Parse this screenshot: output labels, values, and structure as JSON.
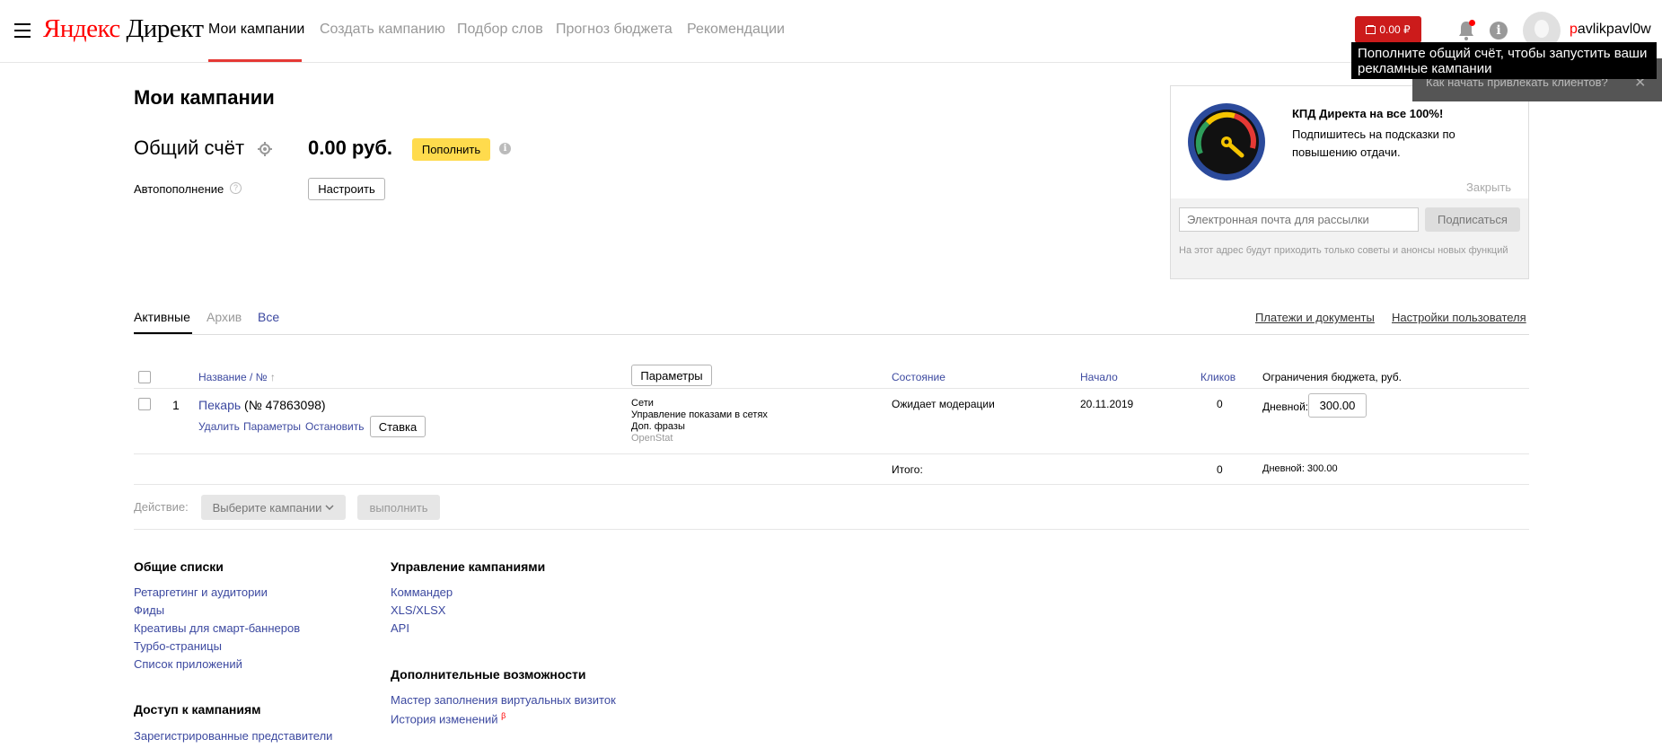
{
  "header": {
    "logo": {
      "ya": "Яндекс",
      "direct": "Директ"
    },
    "nav": [
      "Мои кампании",
      "Создать кампанию",
      "Подбор слов",
      "Прогноз бюджета",
      "Рекомендации"
    ],
    "balance": "0.00 ₽",
    "username_first": "p",
    "username_rest": "avlikpavl0w"
  },
  "tooltip": {
    "text": "Пополните общий счёт, чтобы запустить ваши рекламные кампании",
    "behind_text": "Как начать привлекать клиентов?",
    "close": "✕"
  },
  "page": {
    "title": "Мои кампании",
    "account_label": "Общий счёт",
    "amount": "0.00 руб.",
    "topup_label": "Пополнить",
    "autotopup_label": "Автопополнение",
    "autotopup_help": "?",
    "configure_label": "Настроить"
  },
  "promo": {
    "title": "КПД Директа на все 100%!",
    "text": "Подпишитесь на подсказки по повышению отдачи.",
    "close_label": "Закрыть",
    "email_placeholder": "Электронная почта для рассылки",
    "subscribe_label": "Подписаться",
    "note": "На этот адрес будут приходить только советы и анонсы новых функций"
  },
  "tabs": {
    "items": [
      "Активные",
      "Архив",
      "Все"
    ],
    "links": [
      "Платежи и документы",
      "Настройки пользователя"
    ]
  },
  "table": {
    "headers": {
      "name": "Название / №",
      "sort": "↑",
      "params_button": "Параметры",
      "status": "Состояние",
      "start": "Начало",
      "clicks": "Кликов",
      "budget": "Ограничения бюджета, руб."
    },
    "rows": [
      {
        "num": "1",
        "name": "Пекарь",
        "id": "(№ 47863098)",
        "actions": [
          "Удалить",
          "Параметры",
          "Остановить"
        ],
        "bid_label": "Ставка",
        "networks": [
          "Сети",
          "Управление показами в сетях",
          "Доп. фразы",
          "OpenStat"
        ],
        "status": "Ожидает модерации",
        "start": "20.11.2019",
        "clicks": "0",
        "daily_label": "Дневной:",
        "daily_value": "300.00"
      }
    ],
    "total_label": "Итого:",
    "total_clicks": "0",
    "total_budget": "Дневной: 300.00"
  },
  "action_bar": {
    "label": "Действие:",
    "select": "Выберите кампании",
    "execute": "выполнить"
  },
  "footer": {
    "general_title": "Общие списки",
    "general_links": [
      "Ретаргетинг и аудитории",
      "Фиды",
      "Креативы для смарт-баннеров",
      "Турбо-страницы",
      "Список приложений"
    ],
    "access_title": "Доступ к кампаниям",
    "access_links": [
      "Зарегистрированные представители"
    ],
    "manage_title": "Управление кампаниями",
    "manage_links": [
      "Коммандер",
      "XLS/XLSX",
      "API"
    ],
    "extra_title": "Дополнительные возможности",
    "extra_links": [
      "Мастер заполнения виртуальных визиток",
      "История изменений"
    ],
    "beta_mark": "β"
  }
}
